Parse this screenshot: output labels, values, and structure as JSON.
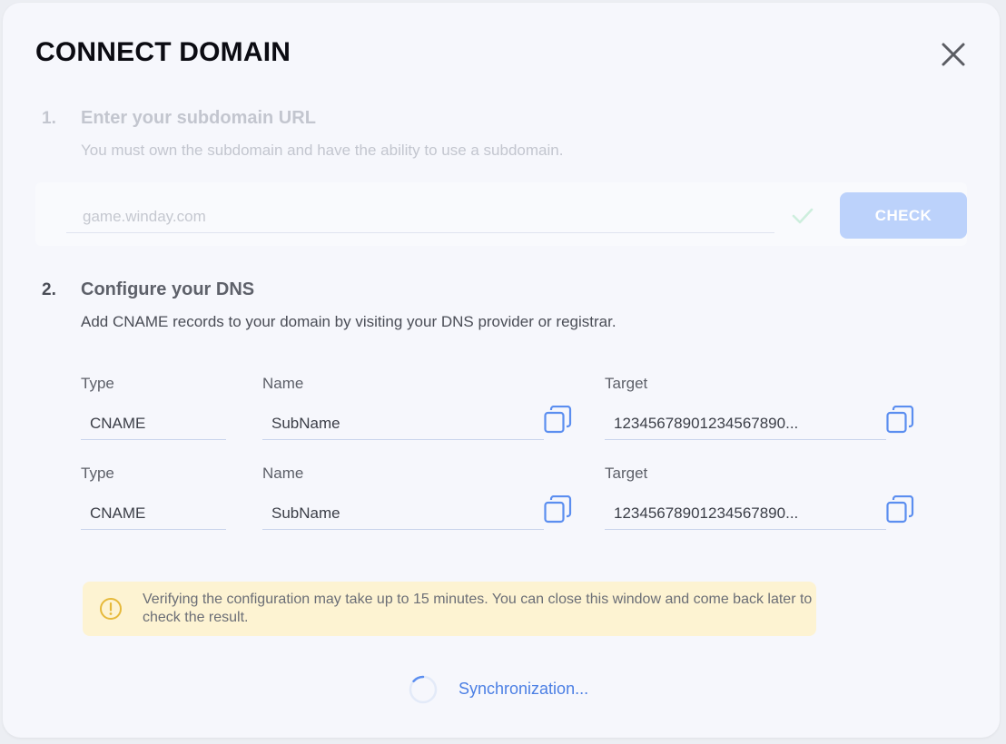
{
  "dialog": {
    "title": "CONNECT DOMAIN"
  },
  "step1": {
    "number": "1.",
    "title": "Enter your subdomain URL",
    "description": "You must own the subdomain and have the ability to use a subdomain.",
    "input_value": "game.winday.com",
    "check_label": "CHECK"
  },
  "step2": {
    "number": "2.",
    "title": "Configure your DNS",
    "description": "Add CNAME records to your domain by visiting your DNS provider or registrar.",
    "records": [
      {
        "type_label": "Type",
        "type_value": "CNAME",
        "name_label": "Name",
        "name_value": "SubName",
        "target_label": "Target",
        "target_value": "12345678901234567890..."
      },
      {
        "type_label": "Type",
        "type_value": "CNAME",
        "name_label": "Name",
        "name_value": "SubName",
        "target_label": "Target",
        "target_value": "12345678901234567890..."
      }
    ]
  },
  "notice": {
    "icon": "warning-circle-icon",
    "text": "Verifying the configuration may take up to 15 minutes. You can close this window and come back later to check the result."
  },
  "status": {
    "text": "Synchronization..."
  },
  "colors": {
    "accent": "#4b7fe4",
    "check_button": "#bcd2fb",
    "notice_bg": "#fdf3d2",
    "notice_icon": "#e6b93a",
    "success_check": "#cdeedd"
  }
}
